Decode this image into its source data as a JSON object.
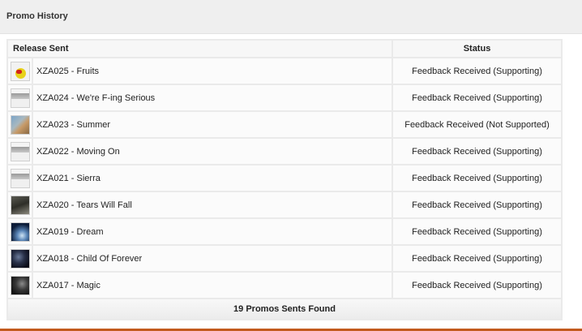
{
  "panel": {
    "title": "Promo History"
  },
  "table": {
    "columns": {
      "release": "Release Sent",
      "status": "Status"
    },
    "rows": [
      {
        "title": "XZA025 - Fruits",
        "status": "Feedback Received (Supporting)",
        "thumb": "fruits"
      },
      {
        "title": "XZA024 - We're F-ing Serious",
        "status": "Feedback Received (Supporting)",
        "thumb": "grey"
      },
      {
        "title": "XZA023 - Summer",
        "status": "Feedback Received (Not Supported)",
        "thumb": "summer"
      },
      {
        "title": "XZA022 - Moving On",
        "status": "Feedback Received (Supporting)",
        "thumb": "grey"
      },
      {
        "title": "XZA021 - Sierra",
        "status": "Feedback Received (Supporting)",
        "thumb": "grey"
      },
      {
        "title": "XZA020 - Tears Will Fall",
        "status": "Feedback Received (Supporting)",
        "thumb": "tears"
      },
      {
        "title": "XZA019 - Dream",
        "status": "Feedback Received (Supporting)",
        "thumb": "dream"
      },
      {
        "title": "XZA018 - Child Of Forever",
        "status": "Feedback Received (Supporting)",
        "thumb": "forever"
      },
      {
        "title": "XZA017 - Magic",
        "status": "Feedback Received (Supporting)",
        "thumb": "magic"
      }
    ],
    "footer": "19 Promos Sents Found"
  },
  "colors": {
    "header_bg": "#efefef",
    "accent_line": "#c25a1e",
    "grid": "#eaeaea"
  }
}
